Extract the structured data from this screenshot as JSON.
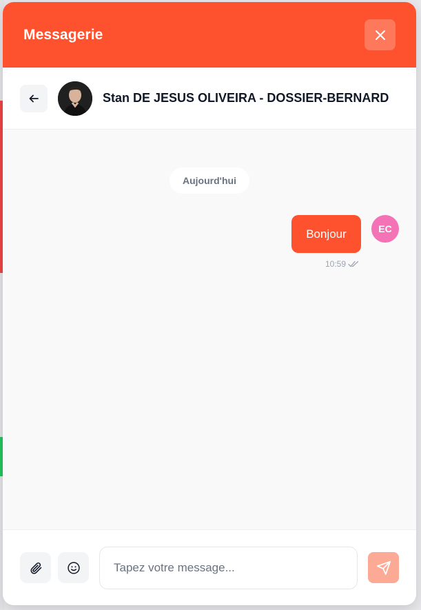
{
  "header": {
    "title": "Messagerie"
  },
  "contact": {
    "name": "Stan DE JESUS OLIVEIRA - DOSSIER-BERNARD"
  },
  "chat": {
    "date_label": "Aujourd'hui",
    "messages": [
      {
        "text": "Bonjour",
        "time": "10:59",
        "sender_initials": "EC"
      }
    ]
  },
  "composer": {
    "placeholder": "Tapez votre message..."
  },
  "icons": {
    "close": "close-icon",
    "back": "arrow-left-icon",
    "attach": "paperclip-icon",
    "emoji": "smiley-icon",
    "send": "send-icon",
    "read": "double-check-icon"
  },
  "colors": {
    "brand": "#fe522e",
    "send_disabled": "#fca995",
    "avatar_bg": "#f472b6",
    "accent_red": "#ef4444",
    "accent_green": "#22c55e"
  }
}
